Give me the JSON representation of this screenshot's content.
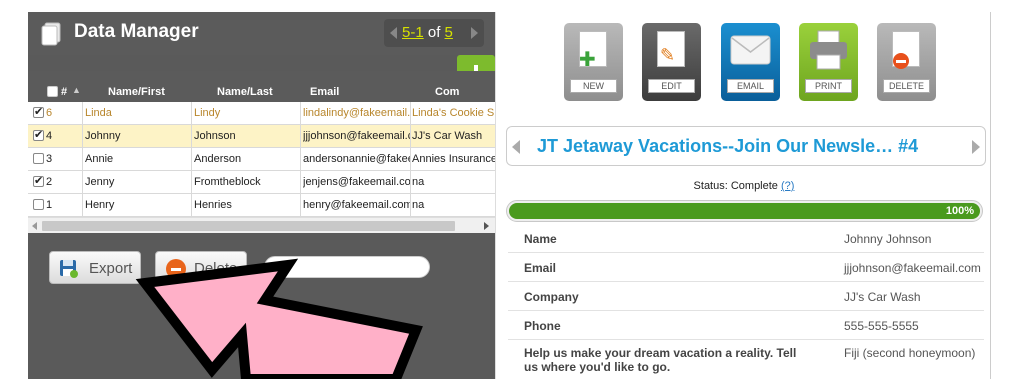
{
  "app": {
    "title": "Data Manager",
    "pager": {
      "start": "5-1",
      "of": "of",
      "total": "5"
    }
  },
  "table": {
    "headers": [
      "#",
      "Name/First",
      "Name/Last",
      "Email",
      "Com"
    ],
    "rows": [
      {
        "checked": true,
        "id": "6",
        "first": "Linda",
        "last": "Lindy",
        "email": "lindalindy@fakeemail.",
        "company": "Linda's Cookie S",
        "highlight": "orange"
      },
      {
        "checked": true,
        "id": "4",
        "first": "Johnny",
        "last": "Johnson",
        "email": "jjjohnson@fakeemail.c",
        "company": "JJ's Car Wash",
        "highlight": "selected"
      },
      {
        "checked": false,
        "id": "3",
        "first": "Annie",
        "last": "Anderson",
        "email": "andersonannie@fakee",
        "company": "Annies Insurance",
        "highlight": "none"
      },
      {
        "checked": true,
        "id": "2",
        "first": "Jenny",
        "last": "Fromtheblock",
        "email": "jenjens@fakeemail.co",
        "company": "na",
        "highlight": "none"
      },
      {
        "checked": false,
        "id": "1",
        "first": "Henry",
        "last": "Henries",
        "email": "henry@fakeemail.com",
        "company": "na",
        "highlight": "none"
      }
    ]
  },
  "actions": {
    "export": "Export",
    "delete": "Delete",
    "search_placeholder": ""
  },
  "toolbar": {
    "new": "NEW",
    "edit": "EDIT",
    "email": "EMAIL",
    "print": "PRINT",
    "delete": "DELETE"
  },
  "record": {
    "title": "JT Jetaway Vacations--Join Our Newsle… #4",
    "status_label": "Status: Complete",
    "status_help": "(?)",
    "progress_pct": "100%",
    "progress_value": 1.0,
    "fields": [
      {
        "label": "Name",
        "value": "Johnny Johnson"
      },
      {
        "label": "Email",
        "value": "jjjohnson@fakeemail.com"
      },
      {
        "label": "Company",
        "value": "JJ's Car Wash"
      },
      {
        "label": "Phone",
        "value": "555-555-5555"
      },
      {
        "label": "Help us make your dream vacation a reality. Tell us where you'd like to go.",
        "value": "Fiji (second honeymoon)"
      }
    ]
  },
  "colors": {
    "accent_blue": "#1e9ad6",
    "progress_green": "#4a9a1e",
    "add_green": "#7dbb2d",
    "pager_link": "#d6e100",
    "arrow_pink": "#ffb0c8"
  }
}
